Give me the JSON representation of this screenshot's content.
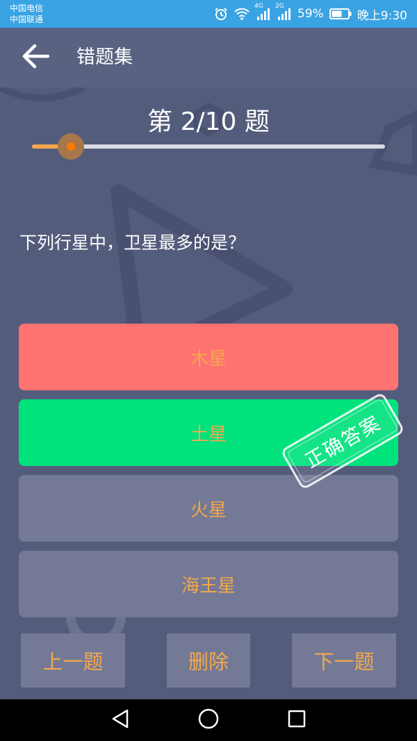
{
  "status_bar": {
    "carrier_1": "中国电信",
    "carrier_2": "中国联通",
    "signal_1_label": "4G",
    "signal_2_label": "2G",
    "battery": "59%",
    "time": "晚上9:30",
    "icons": [
      "alarm-icon",
      "wifi-icon",
      "signal-icon",
      "signal-icon",
      "battery-icon"
    ]
  },
  "app_bar": {
    "title": "错题集",
    "back_icon": "arrow-left-icon"
  },
  "progress": {
    "label": "第 2/10 题",
    "current": 2,
    "total": 10,
    "fraction": 0.11
  },
  "question": {
    "text": "下列行星中，卫星最多的是？"
  },
  "options": [
    {
      "label": "木星",
      "state": "wrong"
    },
    {
      "label": "土星",
      "state": "correct"
    },
    {
      "label": "火星",
      "state": "normal"
    },
    {
      "label": "海王星",
      "state": "normal"
    }
  ],
  "stamp": {
    "text": "正确答案"
  },
  "buttons": {
    "prev": "上一题",
    "delete": "删除",
    "next": "下一题"
  },
  "nav_bar": {
    "icons": [
      "back-triangle-icon",
      "home-circle-icon",
      "recents-square-icon"
    ]
  },
  "colors": {
    "status_bar": "#3aa3e3",
    "background": "#545c7c",
    "wrong": "#ff7272",
    "correct": "#00e27c",
    "option_default": "#747a96",
    "accent_text": "#f4a84c"
  }
}
